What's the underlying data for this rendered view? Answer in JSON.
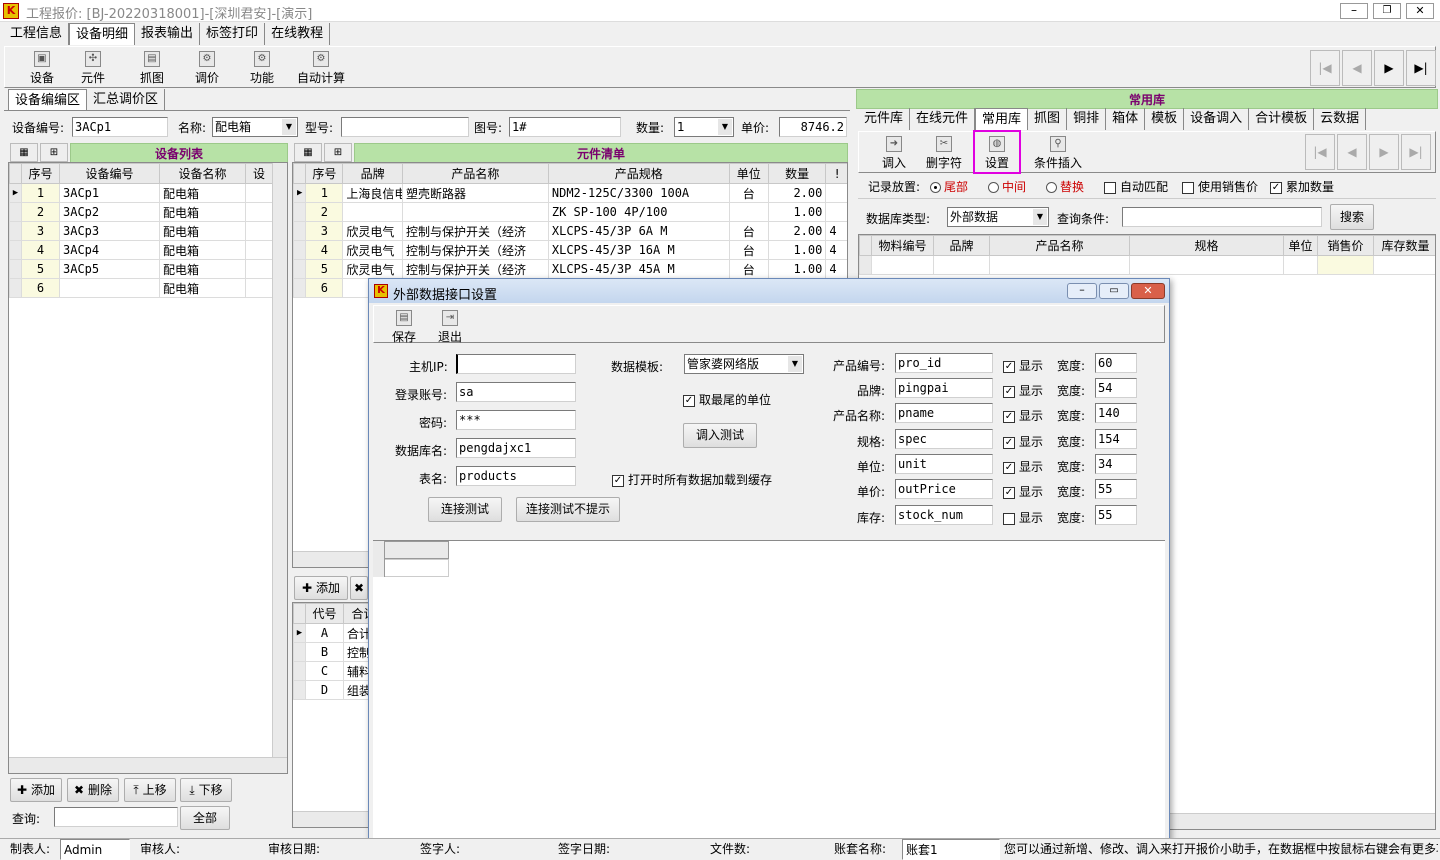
{
  "window": {
    "title": "工程报价: [BJ-20220318001]-[深圳君安]-[演示]"
  },
  "menu": [
    "工程信息",
    "设备明细",
    "报表输出",
    "标签打印",
    "在线教程"
  ],
  "toolbar": [
    "设备",
    "元件",
    "抓图",
    "调价",
    "功能",
    "自动计算"
  ],
  "left_tabs": [
    "设备编编区",
    "汇总调价区"
  ],
  "device_form": {
    "code_label": "设备编号:",
    "code_value": "3ACp1",
    "name_label": "名称:",
    "name_value": "配电箱",
    "model_label": "型号:",
    "model_value": "",
    "drawing_label": "图号:",
    "drawing_value": "1#",
    "qty_label": "数量:",
    "qty_value": "1",
    "price_label": "单价:",
    "price_value": "8746.2"
  },
  "device_list": {
    "title": "设备列表",
    "columns": [
      "序号",
      "设备编号",
      "设备名称",
      "设"
    ],
    "rows": [
      [
        "1",
        "3ACp1",
        "配电箱"
      ],
      [
        "2",
        "3ACp2",
        "配电箱"
      ],
      [
        "3",
        "3ACp3",
        "配电箱"
      ],
      [
        "4",
        "3ACp4",
        "配电箱"
      ],
      [
        "5",
        "3ACp5",
        "配电箱"
      ],
      [
        "6",
        "",
        "配电箱"
      ]
    ]
  },
  "component_list": {
    "title": "元件清单",
    "columns": [
      "序号",
      "品牌",
      "产品名称",
      "产品规格",
      "单位",
      "数量",
      "!"
    ],
    "rows": [
      [
        "1",
        "上海良信电",
        "塑壳断路器",
        "NDM2-125C/3300 100A",
        "台",
        "2.00",
        ""
      ],
      [
        "2",
        "",
        "",
        "ZK SP-100 4P/100",
        "",
        "1.00",
        ""
      ],
      [
        "3",
        "欣灵电气",
        "控制与保护开关（经济",
        "XLCPS-45/3P 6A M",
        "台",
        "2.00",
        "4"
      ],
      [
        "4",
        "欣灵电气",
        "控制与保护开关（经济",
        "XLCPS-45/3P 16A M",
        "台",
        "1.00",
        "4"
      ],
      [
        "5",
        "欣灵电气",
        "控制与保护开关（经济",
        "XLCPS-45/3P 45A M",
        "台",
        "1.00",
        "4"
      ],
      [
        "6",
        "",
        "",
        "",
        "",
        "",
        ""
      ]
    ]
  },
  "middle_bottom": {
    "add_label": "添加",
    "columns": [
      "代号",
      "合计"
    ],
    "rows": [
      [
        "A",
        "合计"
      ],
      [
        "B",
        "控制"
      ],
      [
        "C",
        "辅料"
      ],
      [
        "D",
        "组装"
      ]
    ]
  },
  "left_bottom": {
    "add": "添加",
    "delete": "删除",
    "up": "上移",
    "down": "下移",
    "query_label": "查询:",
    "all": "全部"
  },
  "library": {
    "title": "常用库",
    "tabs": [
      "元件库",
      "在线元件",
      "常用库",
      "抓图",
      "铜排",
      "箱体",
      "模板",
      "设备调入",
      "合计模板",
      "云数据"
    ],
    "tools": [
      "调入",
      "删字符",
      "设置",
      "条件插入"
    ],
    "record_label": "记录放置:",
    "radios": [
      "尾部",
      "中间",
      "替换"
    ],
    "checks": [
      "自动匹配",
      "使用销售价",
      "累加数量"
    ],
    "dbtype_label": "数据库类型:",
    "dbtype_value": "外部数据",
    "query_label": "查询条件:",
    "search": "搜索",
    "columns": [
      "物料编号",
      "品牌",
      "产品名称",
      "规格",
      "单位",
      "销售价",
      "库存数量"
    ]
  },
  "dialog": {
    "title": "外部数据接口设置",
    "save": "保存",
    "exit": "退出",
    "host_label": "主机IP:",
    "host_value": "",
    "user_label": "登录账号:",
    "user_value": "sa",
    "pwd_label": "密码:",
    "pwd_value": "***",
    "db_label": "数据库名:",
    "db_value": "pengdajxc1",
    "table_label": "表名:",
    "table_value": "products",
    "template_label": "数据模板:",
    "template_value": "管家婆网络版",
    "min_unit": "取最尾的单位",
    "import_test": "调入测试",
    "cache_all": "打开时所有数据加载到缓存",
    "conn_test": "连接测试",
    "conn_test_silent": "连接测试不提示",
    "show_label": "显示",
    "width_label": "宽度:",
    "fields": [
      {
        "label": "产品编号:",
        "value": "pro_id",
        "show": true,
        "width": "60"
      },
      {
        "label": "品牌:",
        "value": "pingpai",
        "show": true,
        "width": "54"
      },
      {
        "label": "产品名称:",
        "value": "pname",
        "show": true,
        "width": "140"
      },
      {
        "label": "规格:",
        "value": "spec",
        "show": true,
        "width": "154"
      },
      {
        "label": "单位:",
        "value": "unit",
        "show": true,
        "width": "34"
      },
      {
        "label": "单价:",
        "value": "outPrice",
        "show": true,
        "width": "55"
      },
      {
        "label": "库存:",
        "value": "stock_num",
        "show": false,
        "width": "55"
      }
    ]
  },
  "status": {
    "maker_label": "制表人:",
    "maker": "Admin",
    "reviewer_label": "审核人:",
    "review_date_label": "审核日期:",
    "signer_label": "签字人:",
    "sign_date_label": "签字日期:",
    "files_label": "文件数:",
    "account_label": "账套名称:",
    "account": "账套1",
    "hint": "您可以通过新增、修改、调入来打开报价小助手，在数据框中按鼠标右键会有更多功能"
  }
}
